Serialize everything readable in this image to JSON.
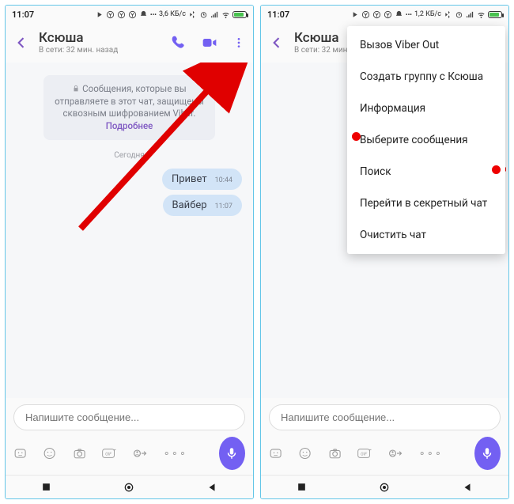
{
  "statusbar": {
    "time": "11:07",
    "speed_left": "3,6 КБ/с",
    "speed_right": "1,2 КБ/с",
    "battery": "79"
  },
  "header": {
    "name": "Ксюша",
    "status": "В сети: 32 мин. назад"
  },
  "encryption": {
    "line1_full": "Сообщения, которые вы",
    "line2_full": "отправляете в этот чат, защищены",
    "line3_full": "сквозным шифрованием Viber.",
    "more": "Подробнее",
    "line1_cut": "Соо",
    "line2_cut": "отправл",
    "line3_cut": "сквозны"
  },
  "daylabel": "Сегодня",
  "messages": [
    {
      "text": "Привет",
      "time": "10:44"
    },
    {
      "text": "Вайбер",
      "time": "11:07"
    }
  ],
  "composer": {
    "placeholder": "Напишите сообщение..."
  },
  "menu": {
    "items": [
      "Вызов Viber Out",
      "Создать группу с Ксюша",
      "Информация",
      "Выберите сообщения",
      "Поиск",
      "Перейти в секретный чат",
      "Очистить чат"
    ]
  }
}
